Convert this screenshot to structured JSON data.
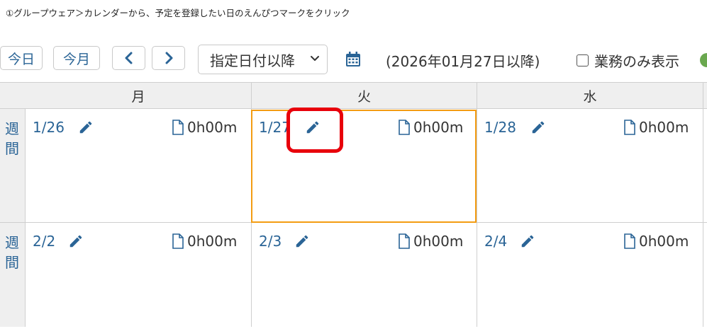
{
  "instruction": "①グループウェア＞カレンダーから、予定を登録したい日のえんぴつマークをクリック",
  "toolbar": {
    "today_label": "今日",
    "this_month_label": "今月",
    "select_value": "指定日付以降",
    "range_text": "(2026年01月27日以降)",
    "checkbox_label": "業務のみ表示"
  },
  "headers": [
    "月",
    "火",
    "水"
  ],
  "week_label": "週間",
  "weeks": [
    {
      "days": [
        {
          "date": "1/26",
          "duration": "0h00m"
        },
        {
          "date": "1/27",
          "duration": "0h00m"
        },
        {
          "date": "1/28",
          "duration": "0h00m"
        }
      ]
    },
    {
      "days": [
        {
          "date": "2/2",
          "duration": "0h00m"
        },
        {
          "date": "2/3",
          "duration": "0h00m"
        },
        {
          "date": "2/4",
          "duration": "0h00m"
        }
      ]
    }
  ],
  "colors": {
    "link": "#2a6496",
    "accent_frame": "#f39c12",
    "highlight": "#e8000b"
  }
}
